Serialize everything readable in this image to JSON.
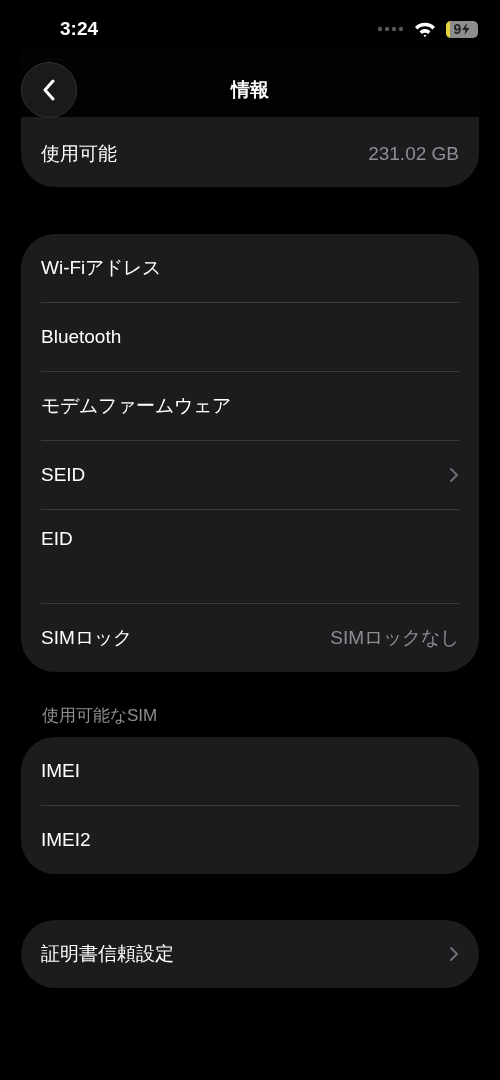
{
  "status_bar": {
    "time": "3:24",
    "battery": "9"
  },
  "nav": {
    "title": "情報"
  },
  "groups": [
    {
      "kind": "top",
      "rows": [
        {
          "kind": "plain",
          "label": "使用可能",
          "value": "231.02 GB",
          "chevron": false
        }
      ]
    },
    {
      "kind": "card",
      "rows": [
        {
          "kind": "plain",
          "label": "Wi-Fiアドレス",
          "chevron": false
        },
        {
          "kind": "plain",
          "label": "Bluetooth",
          "chevron": false
        },
        {
          "kind": "plain",
          "label": "モデムファームウェア",
          "chevron": false
        },
        {
          "kind": "plain",
          "label": "SEID",
          "chevron": true
        },
        {
          "kind": "tall",
          "label": "EID",
          "chevron": false
        },
        {
          "kind": "plain",
          "label": "SIMロック",
          "value": "SIMロックなし",
          "chevron": false
        }
      ]
    },
    {
      "kind": "card",
      "header": "使用可能なSIM",
      "rows": [
        {
          "kind": "plain",
          "label": "IMEI",
          "chevron": false
        },
        {
          "kind": "plain",
          "label": "IMEI2",
          "chevron": false
        }
      ]
    },
    {
      "kind": "card",
      "rows": [
        {
          "kind": "plain",
          "label": "証明書信頼設定",
          "chevron": true
        }
      ]
    }
  ]
}
